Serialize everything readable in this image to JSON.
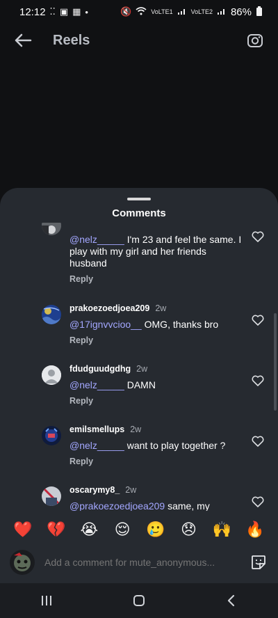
{
  "status_bar": {
    "time": "12:12",
    "left_icons": [
      "dots-icon",
      "gallery-icon",
      "calendar-icon",
      "dot-icon"
    ],
    "right_icons": [
      "mute-icon",
      "wifi-icon",
      "volte-lte1-icon",
      "volte-lte2-icon",
      "signal-icon",
      "battery-icon"
    ],
    "volte1": "VoLTE1",
    "volte2": "VoLTE2",
    "battery": "86%"
  },
  "header": {
    "title": "Reels",
    "back_icon": "arrow-left-icon",
    "camera_icon": "camera-icon"
  },
  "sheet": {
    "title": "Comments",
    "comments": [
      {
        "username": "",
        "time": "",
        "mention": "@nelz_____",
        "text": " I'm 23 and feel the same. I play with my girl and her friends husband",
        "reply": "Reply"
      },
      {
        "username": "prakoezoedjoea209",
        "time": "2w",
        "mention": "@17ignvvcioo__",
        "text": " OMG, thanks bro",
        "reply": "Reply"
      },
      {
        "username": "fdudguudgdhg",
        "time": "2w",
        "mention": "@nelz_____",
        "text": " DAMN",
        "reply": "Reply"
      },
      {
        "username": "emilsmellups",
        "time": "2w",
        "mention": "@nelz_____",
        "text": " want to play together ?",
        "reply": "Reply"
      },
      {
        "username": "oscarymy8_",
        "time": "2w",
        "mention": "@prakoezoedjoea209",
        "text": " same, my",
        "reply": ""
      }
    ]
  },
  "emoji_bar": [
    "❤️",
    "💔",
    "😭",
    "😌",
    "🥲",
    "😞",
    "🙌",
    "🔥"
  ],
  "input": {
    "placeholder": "Add a comment for mute_anonymous..."
  },
  "nav": {
    "recents_icon": "recents-icon",
    "home_icon": "home-icon",
    "back_icon": "chevron-left-icon"
  },
  "colors": {
    "background": "#101113",
    "sheet": "#262a30",
    "mention": "#a3a7ff",
    "reply": "#b3b7be"
  }
}
